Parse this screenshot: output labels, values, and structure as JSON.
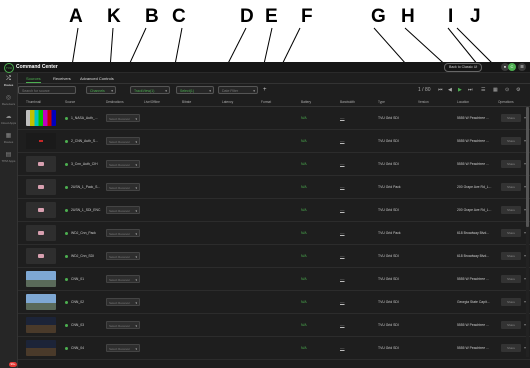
{
  "callouts": [
    "A",
    "K",
    "B",
    "C",
    "D",
    "E",
    "F",
    "G",
    "H",
    "I",
    "J"
  ],
  "app": {
    "title": "Command Center",
    "back_link": "Back to Classic UI",
    "user_initial": "C"
  },
  "sidebar": [
    {
      "label": "Routes",
      "icon": "route-icon",
      "active": true
    },
    {
      "label": "Receivers",
      "icon": "receiver-icon",
      "active": false
    },
    {
      "label": "Cloud Apps",
      "icon": "cloud-icon",
      "active": false
    },
    {
      "label": "Routes",
      "icon": "network-icon",
      "active": false
    },
    {
      "label": "TPM Apps",
      "icon": "apps-icon",
      "active": false
    }
  ],
  "sidebar_badge": "99+",
  "tabs": [
    "Sources",
    "Receivers",
    "Advanced Controls"
  ],
  "filters": [
    {
      "label": "Search for source",
      "dim": true
    },
    {
      "label": "Channels",
      "dim": false
    },
    {
      "label": "TrackView(1)",
      "dim": false
    },
    {
      "label": "Select(1)",
      "dim": false
    },
    {
      "label": "Date Filter",
      "dim": true
    }
  ],
  "view_controls": {
    "pager": "1 / 80"
  },
  "columns": [
    "Thumbnail",
    "Source",
    "Destinations",
    "Live/Offline",
    "Bitrate",
    "Latency",
    "Format",
    "Battery",
    "Bandwidth",
    "Type",
    "Version",
    "Location",
    "Operations"
  ],
  "rows": [
    {
      "thumb": "bars",
      "source": "1_NASA_Auth_...",
      "dest": "Select Receiver",
      "battery": "N/A",
      "bandwidth": "----",
      "type": "TVU Grid SDI",
      "location": "5555 W Peachtree ..."
    },
    {
      "thumb": "live",
      "source": "2_CNN_Auth_S...",
      "dest": "Select Receiver",
      "battery": "N/A",
      "bandwidth": "----",
      "type": "TVU Grid SDI",
      "location": "5555 W Peachtree ..."
    },
    {
      "thumb": "placeholder",
      "source": "3_Cnn_Auth_CIH",
      "dest": "Select Receiver",
      "battery": "N/A",
      "bandwidth": "----",
      "type": "TVU Grid SDI",
      "location": "5555 W Peachtree ..."
    },
    {
      "thumb": "placeholder",
      "source": "2USN_1_Pack_S...",
      "dest": "Select Receiver",
      "battery": "N/A",
      "bandwidth": "----",
      "type": "TVU Grid Pack",
      "location": "200 Grape Ave Rd_L..."
    },
    {
      "thumb": "placeholder",
      "source": "2USN_1_SDI_ENC",
      "dest": "Select Receiver",
      "battery": "N/A",
      "bandwidth": "----",
      "type": "TVU Grid SDI",
      "location": "200 Grape Ave Rd_L..."
    },
    {
      "thumb": "placeholder",
      "source": "WDJ_Cnn_Pack",
      "dest": "Select Receiver",
      "battery": "N/A",
      "bandwidth": "----",
      "type": "TVU Grid Pack",
      "location": "618 Broadway Blvd..."
    },
    {
      "thumb": "placeholder",
      "source": "WDJ_Cnn_SDI",
      "dest": "Select Receiver",
      "battery": "N/A",
      "bandwidth": "----",
      "type": "TVU Grid SDI",
      "location": "618 Broadway Blvd..."
    },
    {
      "thumb": "sky",
      "source": "CNN_01",
      "dest": "Select Receiver",
      "battery": "N/A",
      "bandwidth": "----",
      "type": "TVU Grid SDI",
      "location": "5555 W Peachtree ..."
    },
    {
      "thumb": "sky",
      "source": "CNN_02",
      "dest": "Select Receiver",
      "battery": "N/A",
      "bandwidth": "----",
      "type": "TVU Grid SDI",
      "location": "Georgia State Capit..."
    },
    {
      "thumb": "night",
      "source": "CNN_03",
      "dest": "Select Receiver",
      "battery": "N/A",
      "bandwidth": "----",
      "type": "TVU Grid SDI",
      "location": "5555 W Peachtree ..."
    },
    {
      "thumb": "night",
      "source": "CNN_04",
      "dest": "Select Receiver",
      "battery": "N/A",
      "bandwidth": "----",
      "type": "TVU Grid SDI",
      "location": "5555 W Peachtree ..."
    }
  ],
  "row_operation_label": "Share",
  "colors": {
    "accent": "#4caf50",
    "background": "#1e1e1e",
    "badge": "#e53935"
  }
}
